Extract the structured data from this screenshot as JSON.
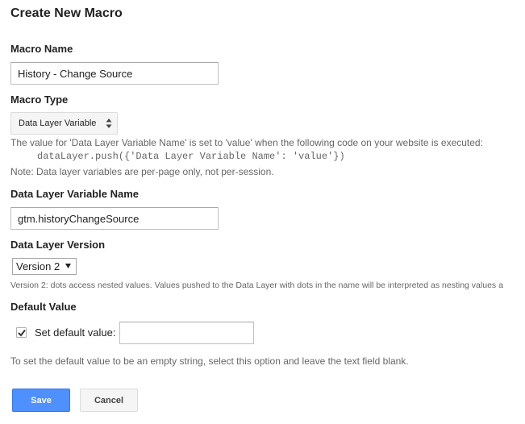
{
  "page": {
    "title": "Create New Macro"
  },
  "macro_name": {
    "label": "Macro Name",
    "value": "History - Change Source"
  },
  "macro_type": {
    "label": "Macro Type",
    "selected": "Data Layer Variable",
    "description": "The value for 'Data Layer Variable Name' is set to 'value' when the following code on your website is executed:",
    "code": "dataLayer.push({'Data Layer Variable Name': 'value'})",
    "note": "Note: Data layer variables are per-page only, not per-session."
  },
  "variable_name": {
    "label": "Data Layer Variable Name",
    "value": "gtm.historyChangeSource"
  },
  "version": {
    "label": "Data Layer Version",
    "selected": "Version 2",
    "description": "Version 2: dots access nested values. Values pushed to the Data Layer with dots in the name will be interpreted as nesting values a"
  },
  "default_value": {
    "label": "Default Value",
    "checkbox_label": "Set default value:",
    "checked": true,
    "value": "",
    "hint": "To set the default value to be an empty string, select this option and leave the text field blank."
  },
  "buttons": {
    "save": "Save",
    "cancel": "Cancel"
  },
  "colors": {
    "primary_button": "#4d90fe",
    "secondary_button": "#f5f5f5",
    "muted_text": "#666666"
  },
  "icons": {
    "macro_type_select": "up-down-arrows-icon",
    "version_select": "dropdown-triangle-icon",
    "checkbox": "checkmark-icon"
  }
}
